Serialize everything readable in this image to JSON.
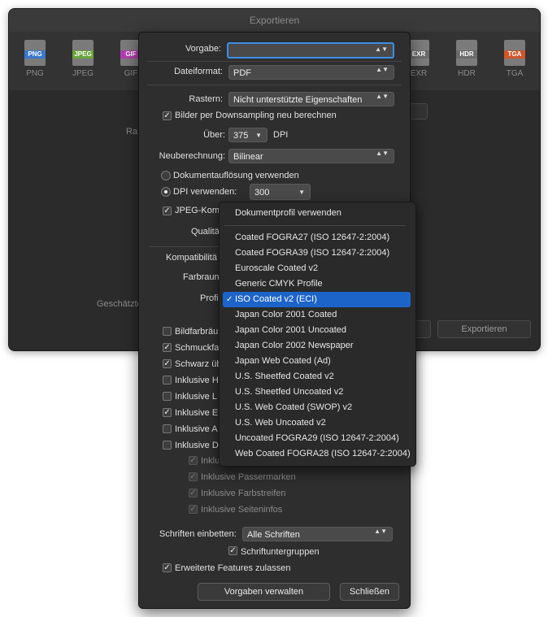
{
  "background_window": {
    "title": "Exportieren",
    "formats_left": [
      {
        "tag": "PNG",
        "label": "PNG",
        "color": "#3a78c9"
      },
      {
        "tag": "JPEG",
        "label": "JPEG",
        "color": "#6aa43a"
      },
      {
        "tag": "GIF",
        "label": "GIF",
        "color": "#b03db0"
      }
    ],
    "formats_right": [
      {
        "tag": "EXR",
        "label": "EXR",
        "color": "#6b6b6b"
      },
      {
        "tag": "HDR",
        "label": "HDR",
        "color": "#6b6b6b"
      },
      {
        "tag": "TGA",
        "label": "TGA",
        "color": "#d0562c"
      }
    ],
    "partial_label_ra": "Ra",
    "partial_label_geschaetzt": "Geschätzte",
    "export_button": "Exportieren"
  },
  "dialog": {
    "preset_label": "Vorgabe:",
    "preset_value": "",
    "format_label": "Dateiformat:",
    "format_value": "PDF",
    "raster_label": "Rastern:",
    "raster_value": "Nicht unterstützte Eigenschaften",
    "downsampling_label": "Bilder per Downsampling neu berechnen",
    "over_label": "Über:",
    "over_value": "375",
    "dpi_label": "DPI",
    "resample_label": "Neuberechnung:",
    "resample_value": "Bilinear",
    "doc_resolution_label": "Dokumentauflösung verwenden",
    "use_dpi_label": "DPI verwenden:",
    "use_dpi_value": "300",
    "jpeg_label": "JPEG-Komp",
    "quality_label": "Qualitä",
    "compat_label": "Kompatibilitä",
    "colorspace_label": "Farbraun",
    "profile_label": "Profi",
    "options": [
      {
        "label": "Bildfarbräu",
        "checked": false
      },
      {
        "label": "Schmuckfa",
        "checked": true
      },
      {
        "label": "Schwarz üb",
        "checked": true
      },
      {
        "label": "Inklusive H",
        "checked": false
      },
      {
        "label": "Inklusive L",
        "checked": false
      },
      {
        "label": "Inklusive E",
        "checked": true
      },
      {
        "label": "Inklusive A",
        "checked": false
      },
      {
        "label": "Inklusive D",
        "checked": false
      }
    ],
    "sub_options": [
      {
        "label": "Inklus"
      },
      {
        "label": "Inklusive Passermarken"
      },
      {
        "label": "Inklusive Farbstreifen"
      },
      {
        "label": "Inklusive Seiteninfos"
      }
    ],
    "embed_fonts_label": "Schriften einbetten:",
    "embed_fonts_value": "Alle Schriften",
    "font_subsets_label": "Schriftuntergruppen",
    "advanced_label": "Erweiterte Features zulassen",
    "manage_presets_button": "Vorgaben verwalten",
    "close_button": "Schließen",
    "check_glyph": "✓",
    "popup_arrows": "▲▼",
    "dropdown_arrow": "▼"
  },
  "profile_menu": {
    "items": [
      {
        "label": "Dokumentprofil verwenden",
        "selected": false
      },
      {
        "label": "Coated FOGRA27 (ISO 12647-2:2004)",
        "selected": false
      },
      {
        "label": "Coated FOGRA39 (ISO 12647-2:2004)",
        "selected": false
      },
      {
        "label": "Euroscale Coated v2",
        "selected": false
      },
      {
        "label": "Generic CMYK Profile",
        "selected": false
      },
      {
        "label": "ISO Coated v2 (ECI)",
        "selected": true
      },
      {
        "label": "Japan Color 2001 Coated",
        "selected": false
      },
      {
        "label": "Japan Color 2001 Uncoated",
        "selected": false
      },
      {
        "label": "Japan Color 2002 Newspaper",
        "selected": false
      },
      {
        "label": "Japan Web Coated (Ad)",
        "selected": false
      },
      {
        "label": "U.S. Sheetfed Coated v2",
        "selected": false
      },
      {
        "label": "U.S. Sheetfed Uncoated v2",
        "selected": false
      },
      {
        "label": "U.S. Web Coated (SWOP) v2",
        "selected": false
      },
      {
        "label": "U.S. Web Uncoated v2",
        "selected": false
      },
      {
        "label": "Uncoated FOGRA29 (ISO 12647-2:2004)",
        "selected": false
      },
      {
        "label": "Web Coated FOGRA28 (ISO 12647-2:2004)",
        "selected": false
      }
    ],
    "accent": "#1d64c8"
  }
}
